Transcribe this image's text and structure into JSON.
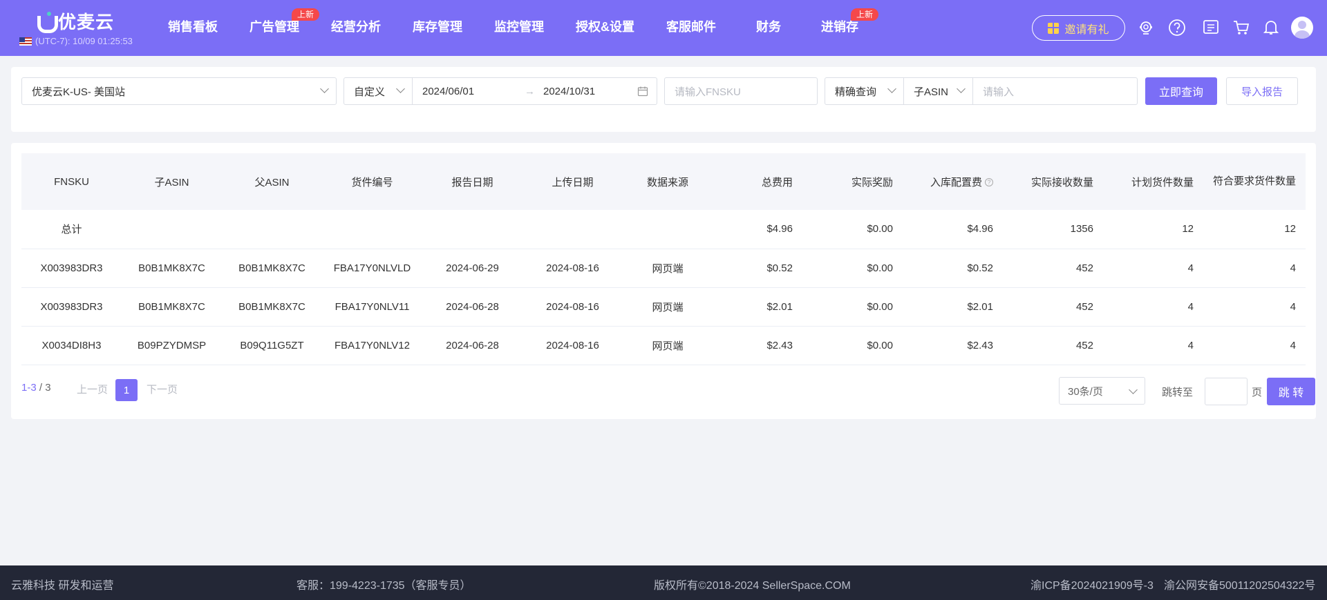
{
  "header": {
    "logo_text": "优麦云",
    "timezone": "(UTC-7): 10/09 01:25:53",
    "nav": [
      {
        "label": "销售看板",
        "badge": ""
      },
      {
        "label": "广告管理",
        "badge": "上新"
      },
      {
        "label": "经营分析",
        "badge": ""
      },
      {
        "label": "库存管理",
        "badge": ""
      },
      {
        "label": "监控管理",
        "badge": ""
      },
      {
        "label": "授权&设置",
        "badge": ""
      },
      {
        "label": "客服邮件",
        "badge": ""
      },
      {
        "label": "财务",
        "badge": ""
      },
      {
        "label": "进销存",
        "badge": "上新"
      }
    ],
    "invite_label": "邀请有礼",
    "icons": [
      "support-icon",
      "help-icon",
      "message-icon",
      "cart-icon",
      "bell-icon",
      "avatar-icon"
    ]
  },
  "filters": {
    "store": "优麦云K-US- 美国站",
    "date_mode": "自定义",
    "date_start": "2024/06/01",
    "date_end": "2024/10/31",
    "fnsku_placeholder": "请输入FNSKU",
    "match_mode": "精确查询",
    "field": "子ASIN",
    "keyword_placeholder": "请输入",
    "search_label": "立即查询",
    "import_label": "导入报告"
  },
  "table": {
    "columns": [
      "FNSKU",
      "子ASIN",
      "父ASIN",
      "货件编号",
      "报告日期",
      "上传日期",
      "数据来源",
      "总费用",
      "实际奖励",
      "入库配置费",
      "实际接收数量",
      "计划货件数量",
      "符合要求货件数量"
    ],
    "total": {
      "label": "总计",
      "total_fee": "$4.96",
      "actual_reward": "$0.00",
      "inbound_fee": "$4.96",
      "received_qty": "1356",
      "planned_qty": "12",
      "qualified_qty": "12"
    },
    "rows": [
      {
        "fnsku": "X003983DR3",
        "child_asin": "B0B1MK8X7C",
        "parent_asin": "B0B1MK8X7C",
        "shipment_id": "FBA17Y0NLVLD",
        "report_date": "2024-06-29",
        "upload_date": "2024-08-16",
        "source": "网页端",
        "total_fee": "$0.52",
        "actual_reward": "$0.00",
        "inbound_fee": "$0.52",
        "received_qty": "452",
        "planned_qty": "4",
        "qualified_qty": "4"
      },
      {
        "fnsku": "X003983DR3",
        "child_asin": "B0B1MK8X7C",
        "parent_asin": "B0B1MK8X7C",
        "shipment_id": "FBA17Y0NLV11",
        "report_date": "2024-06-28",
        "upload_date": "2024-08-16",
        "source": "网页端",
        "total_fee": "$2.01",
        "actual_reward": "$0.00",
        "inbound_fee": "$2.01",
        "received_qty": "452",
        "planned_qty": "4",
        "qualified_qty": "4"
      },
      {
        "fnsku": "X0034DI8H3",
        "child_asin": "B09PZYDMSP",
        "parent_asin": "B09Q11G5ZT",
        "shipment_id": "FBA17Y0NLV12",
        "report_date": "2024-06-28",
        "upload_date": "2024-08-16",
        "source": "网页端",
        "total_fee": "$2.43",
        "actual_reward": "$0.00",
        "inbound_fee": "$2.43",
        "received_qty": "452",
        "planned_qty": "4",
        "qualified_qty": "4"
      }
    ]
  },
  "pagination": {
    "range": "1-3",
    "total": "/ 3",
    "prev": "上一页",
    "current": "1",
    "next": "下一页",
    "page_size": "30条/页",
    "jump_to": "跳转至",
    "page_unit": "页",
    "jump_button": "跳 转"
  },
  "footer": {
    "company": "云雅科技 研发和运营",
    "service": "客服：199-4223-1735（客服专员）",
    "copyright": "版权所有©2018-2024 SellerSpace.COM",
    "icp": "渝ICP备2024021909号-3",
    "police": "渝公网安备50011202504322号"
  },
  "colors": {
    "brand": "#7b6ef6",
    "badge": "#f5484a",
    "footer_bg": "#232736"
  }
}
